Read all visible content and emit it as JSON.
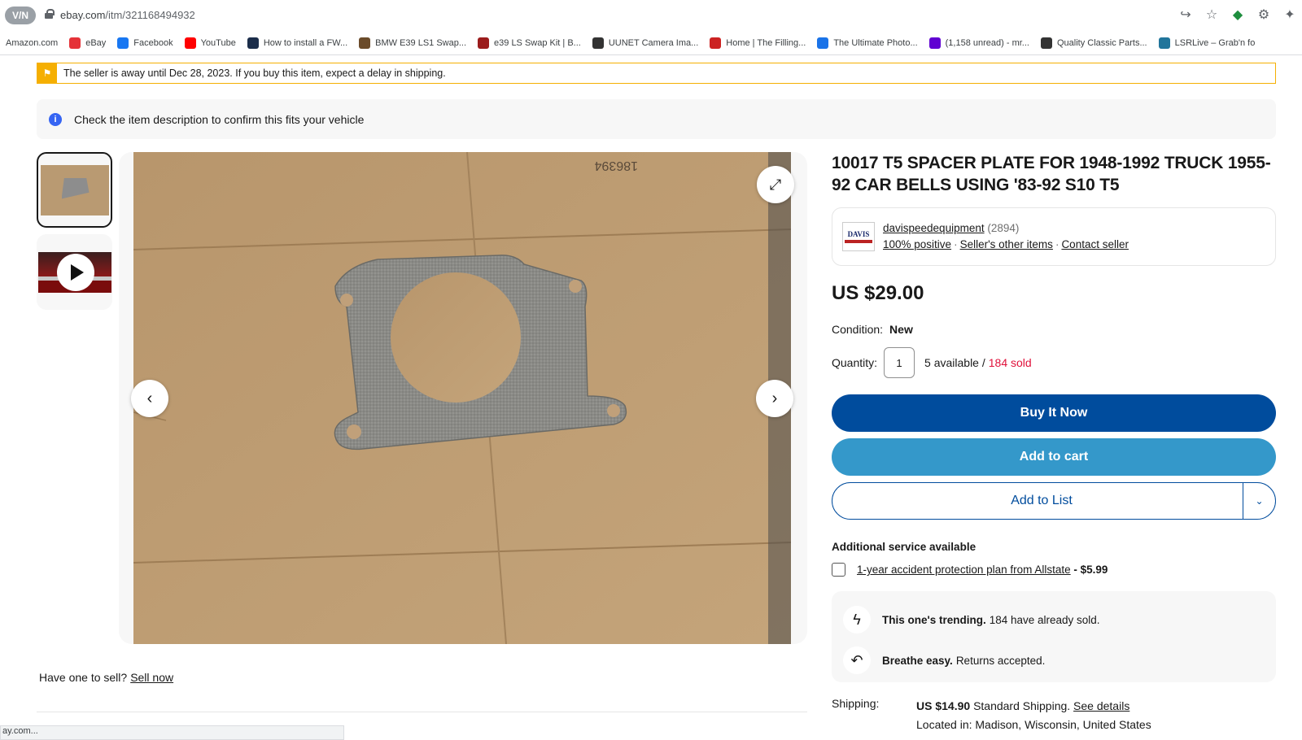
{
  "browser": {
    "vpn_label": "V/N",
    "url_host": "ebay.com",
    "url_path": "/itm/321168494932",
    "bookmarks": [
      {
        "label": "Amazon.com",
        "icon": "amazon-icon",
        "color": "#ffffff"
      },
      {
        "label": "eBay",
        "icon": "ebay-bag-icon",
        "color": "#e53238"
      },
      {
        "label": "Facebook",
        "icon": "facebook-icon",
        "color": "#1877f2"
      },
      {
        "label": "YouTube",
        "icon": "youtube-icon",
        "color": "#ff0000"
      },
      {
        "label": "How to install a FW...",
        "icon": "site-icon",
        "color": "#1b2d4a"
      },
      {
        "label": "BMW E39 LS1 Swap...",
        "icon": "site-icon",
        "color": "#6b4b2a"
      },
      {
        "label": "e39 LS Swap Kit | B...",
        "icon": "site-icon",
        "color": "#9b1c1c"
      },
      {
        "label": "UUNET Camera Ima...",
        "icon": "globe-icon",
        "color": "#333333"
      },
      {
        "label": "Home | The Filling...",
        "icon": "site-icon",
        "color": "#cc2222"
      },
      {
        "label": "The Ultimate Photo...",
        "icon": "site-icon",
        "color": "#1a73e8"
      },
      {
        "label": "(1,158 unread) - mr...",
        "icon": "mail-icon",
        "color": "#6001d2"
      },
      {
        "label": "Quality Classic Parts...",
        "icon": "globe-icon",
        "color": "#333333"
      },
      {
        "label": "LSRLive – Grab'n fo",
        "icon": "wordpress-icon",
        "color": "#21759b"
      }
    ],
    "status_text": "ay.com..."
  },
  "alert": {
    "text": "The seller is away until Dec 28, 2023. If you buy this item, expect a delay in shipping.",
    "color": "#f5af02"
  },
  "fitment": {
    "text": "Check the item description to confirm this fits your vehicle"
  },
  "gallery": {
    "photo_stamp": "186394"
  },
  "sell": {
    "prompt": "Have one to sell?",
    "link": "Sell now"
  },
  "item": {
    "title": "10017 T5 SPACER PLATE FOR 1948-1992 TRUCK 1955-92 CAR BELLS USING '83-92 S10 T5",
    "seller": {
      "logo_text": "DAVIS",
      "name": "davispeedequipment",
      "count": "(2894)",
      "positive": "100% positive",
      "other_items": "Seller's other items",
      "contact": "Contact seller"
    },
    "price": "US $29.00",
    "condition_label": "Condition:",
    "condition_value": "New",
    "quantity_label": "Quantity:",
    "quantity_value": "1",
    "available": "5 available /",
    "sold": "184 sold",
    "buy_now": "Buy It Now",
    "add_cart": "Add to cart",
    "add_list": "Add to List",
    "additional_title": "Additional service available",
    "protection_link": "1-year accident protection plan from Allstate",
    "protection_price": "- $5.99",
    "trending_bold": "This one's trending.",
    "trending_text": "184 have already sold.",
    "returns_bold": "Breathe easy.",
    "returns_text": "Returns accepted.",
    "shipping_label": "Shipping:",
    "shipping_price": "US $14.90",
    "shipping_method": "Standard Shipping.",
    "shipping_link": "See details",
    "location": "Located in: Madison, Wisconsin, United States"
  },
  "colors": {
    "buy_now": "#004c9d",
    "add_cart": "#3498ca",
    "sold_red": "#e0103a",
    "info_blue": "#3665f3"
  }
}
